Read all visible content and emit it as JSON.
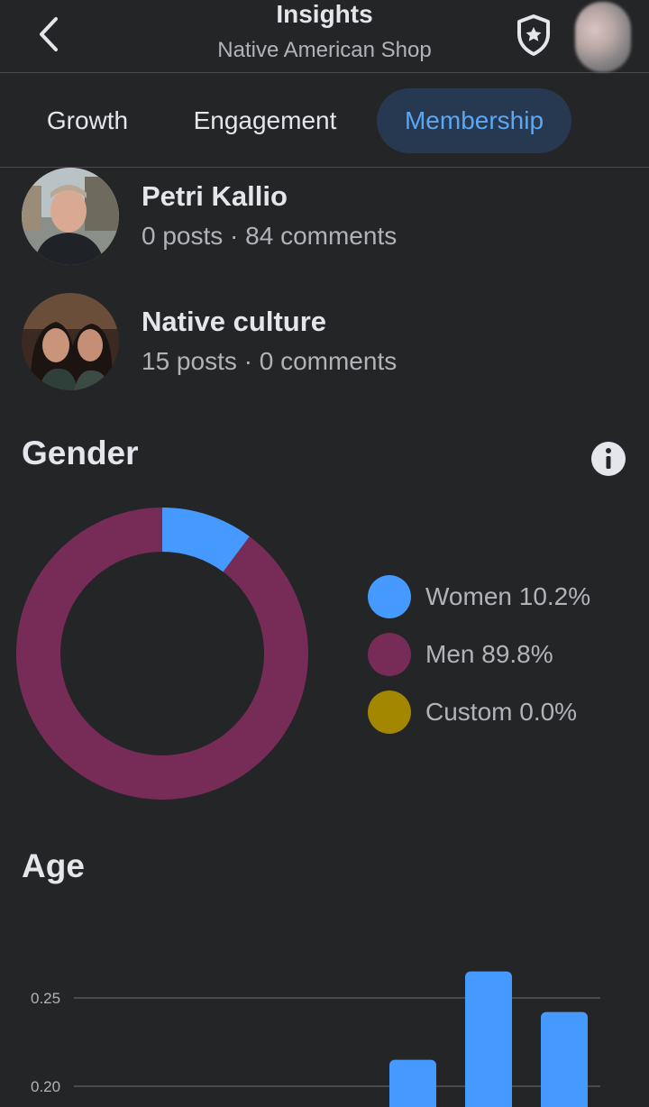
{
  "header": {
    "title": "Insights",
    "subtitle": "Native American Shop",
    "icons": {
      "back": "chevron-left-icon",
      "shield": "shield-star-icon"
    }
  },
  "tabs": [
    {
      "label": "Growth",
      "active": false
    },
    {
      "label": "Engagement",
      "active": false
    },
    {
      "label": "Membership",
      "active": true
    }
  ],
  "members": [
    {
      "name": "Petri Kallio",
      "stats": "0 posts · 84 comments"
    },
    {
      "name": "Native culture",
      "stats": "15 posts · 0 comments"
    }
  ],
  "gender": {
    "title": "Gender",
    "legend": [
      {
        "label": "Women 10.2%",
        "color": "#4599ff"
      },
      {
        "label": "Men 89.8%",
        "color": "#772c58"
      },
      {
        "label": "Custom 0.0%",
        "color": "#a48700"
      }
    ]
  },
  "chart_data": [
    {
      "type": "pie",
      "title": "Gender",
      "categories": [
        "Women",
        "Men",
        "Custom"
      ],
      "values": [
        10.2,
        89.8,
        0.0
      ],
      "colors": [
        "#4599ff",
        "#772c58",
        "#a48700"
      ],
      "donut": true,
      "legend": "right"
    },
    {
      "type": "bar",
      "title": "Age",
      "categories": [
        "",
        "",
        "",
        "",
        "",
        "",
        ""
      ],
      "values": [
        null,
        null,
        null,
        null,
        0.215,
        0.265,
        0.242
      ],
      "yticks": [
        0.2,
        0.25
      ],
      "ytick_labels": [
        "0.20",
        "0.25"
      ],
      "grid": true,
      "color": "#4599ff"
    }
  ],
  "age": {
    "title": "Age"
  }
}
